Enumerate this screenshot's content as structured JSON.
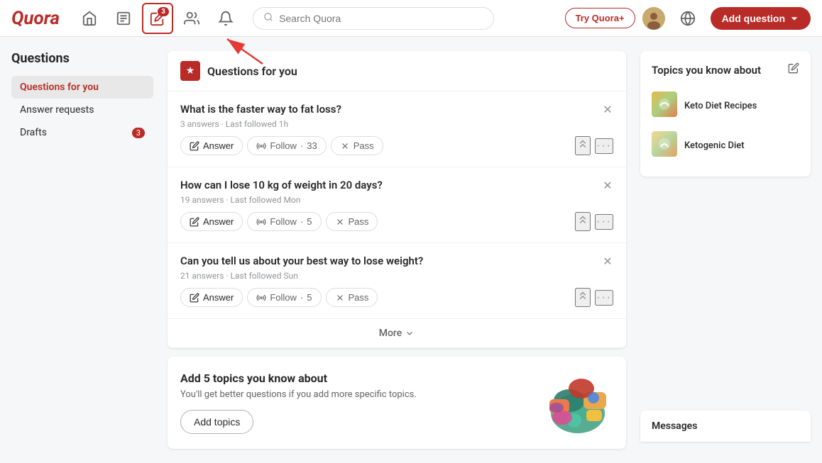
{
  "header": {
    "logo": "Quora",
    "nav": [
      {
        "name": "home",
        "icon": "🏠",
        "label": "Home"
      },
      {
        "name": "answers",
        "icon": "📋",
        "label": "Answers"
      },
      {
        "name": "write",
        "icon": "✏️",
        "label": "Write",
        "badge": 3,
        "highlighted": true
      },
      {
        "name": "spaces",
        "icon": "👥",
        "label": "Spaces"
      },
      {
        "name": "notifications",
        "icon": "🔔",
        "label": "Notifications"
      }
    ],
    "search_placeholder": "Search Quora",
    "try_quora_label": "Try Quora+",
    "add_question_label": "Add question",
    "globe_icon": "🌐"
  },
  "sidebar": {
    "title": "Questions",
    "items": [
      {
        "label": "Questions for you",
        "active": true
      },
      {
        "label": "Answer requests"
      },
      {
        "label": "Drafts",
        "badge": 3
      }
    ]
  },
  "questions_panel": {
    "header_icon": "★",
    "header_title": "Questions for you",
    "questions": [
      {
        "id": 1,
        "title": "What is the faster way to fat loss?",
        "meta": "3 answers · Last followed 1h",
        "follow_count": "33",
        "actions": {
          "answer": "Answer",
          "follow": "Follow",
          "pass": "Pass"
        }
      },
      {
        "id": 2,
        "title": "How can I lose 10 kg of weight in 20 days?",
        "meta": "19 answers · Last followed Mon",
        "follow_count": "5",
        "actions": {
          "answer": "Answer",
          "follow": "Follow",
          "pass": "Pass"
        }
      },
      {
        "id": 3,
        "title": "Can you tell us about your best way to lose weight?",
        "meta": "21 answers · Last followed Sun",
        "follow_count": "5",
        "actions": {
          "answer": "Answer",
          "follow": "Follow",
          "pass": "Pass"
        }
      }
    ],
    "more_label": "More"
  },
  "add_topics": {
    "title": "Add 5 topics you know about",
    "description": "You'll get better questions if you add more specific topics.",
    "button_label": "Add topics"
  },
  "right_panel": {
    "topics_title": "Topics you know about",
    "topics": [
      {
        "name": "Keto Diet Recipes"
      },
      {
        "name": "Ketogenic Diet"
      }
    ],
    "messages_title": "Messages"
  }
}
